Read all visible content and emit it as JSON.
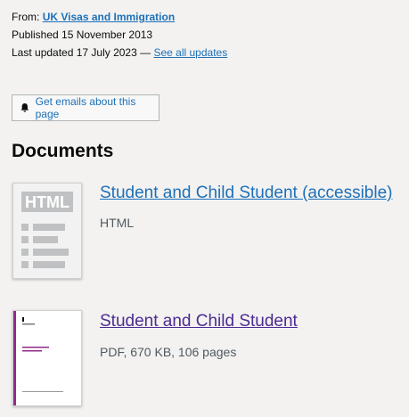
{
  "metadata": {
    "from_label": "From:",
    "organisation": "UK Visas and Immigration",
    "published": "Published 15 November 2013",
    "last_updated": "Last updated 17 July 2023 —",
    "see_all_updates": "See all updates"
  },
  "email_button": {
    "label": "Get emails about this page",
    "icon": "bell-icon"
  },
  "documents": {
    "heading": "Documents",
    "items": [
      {
        "title": "Student and Child Student (accessible)",
        "meta": "HTML",
        "thumbnail": "html-icon",
        "thumb_text": "HTML",
        "link_color": "#1d70b8"
      },
      {
        "title": "Student and Child Student",
        "meta": "PDF, 670 KB, 106 pages",
        "thumbnail": "pdf-cover",
        "link_color": "#4c2c92",
        "accent_color": "#912b88"
      }
    ]
  },
  "colors": {
    "link": "#1d70b8",
    "visited_link": "#4c2c92",
    "background": "#f3f2f1",
    "text": "#0b0c0c",
    "secondary_text": "#505a5f"
  }
}
